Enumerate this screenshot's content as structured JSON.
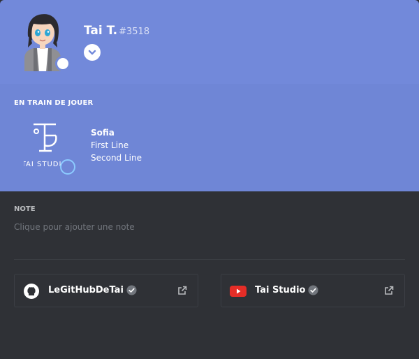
{
  "profile": {
    "username": "Tai T.",
    "discriminator": "#3518",
    "status": "online"
  },
  "activity": {
    "section_label": "EN TRAIN DE JOUER",
    "game_name": "Sofia",
    "line1": "First Line",
    "line2": "Second Line",
    "logo_text": "TAI STUDIO"
  },
  "note": {
    "label": "NOTE",
    "placeholder": "Clique pour ajouter une note"
  },
  "connected_accounts": [
    {
      "name": "LeGitHubDeTai",
      "icon": "github-icon",
      "verified": true
    },
    {
      "name": "Tai Studio",
      "icon": "youtube-icon",
      "verified": true
    }
  ],
  "colors": {
    "header": "#7289da",
    "activity": "#6f86d6",
    "body": "#2f3136",
    "youtube": "#e52d27",
    "badge_ring": "#8ccbff"
  }
}
